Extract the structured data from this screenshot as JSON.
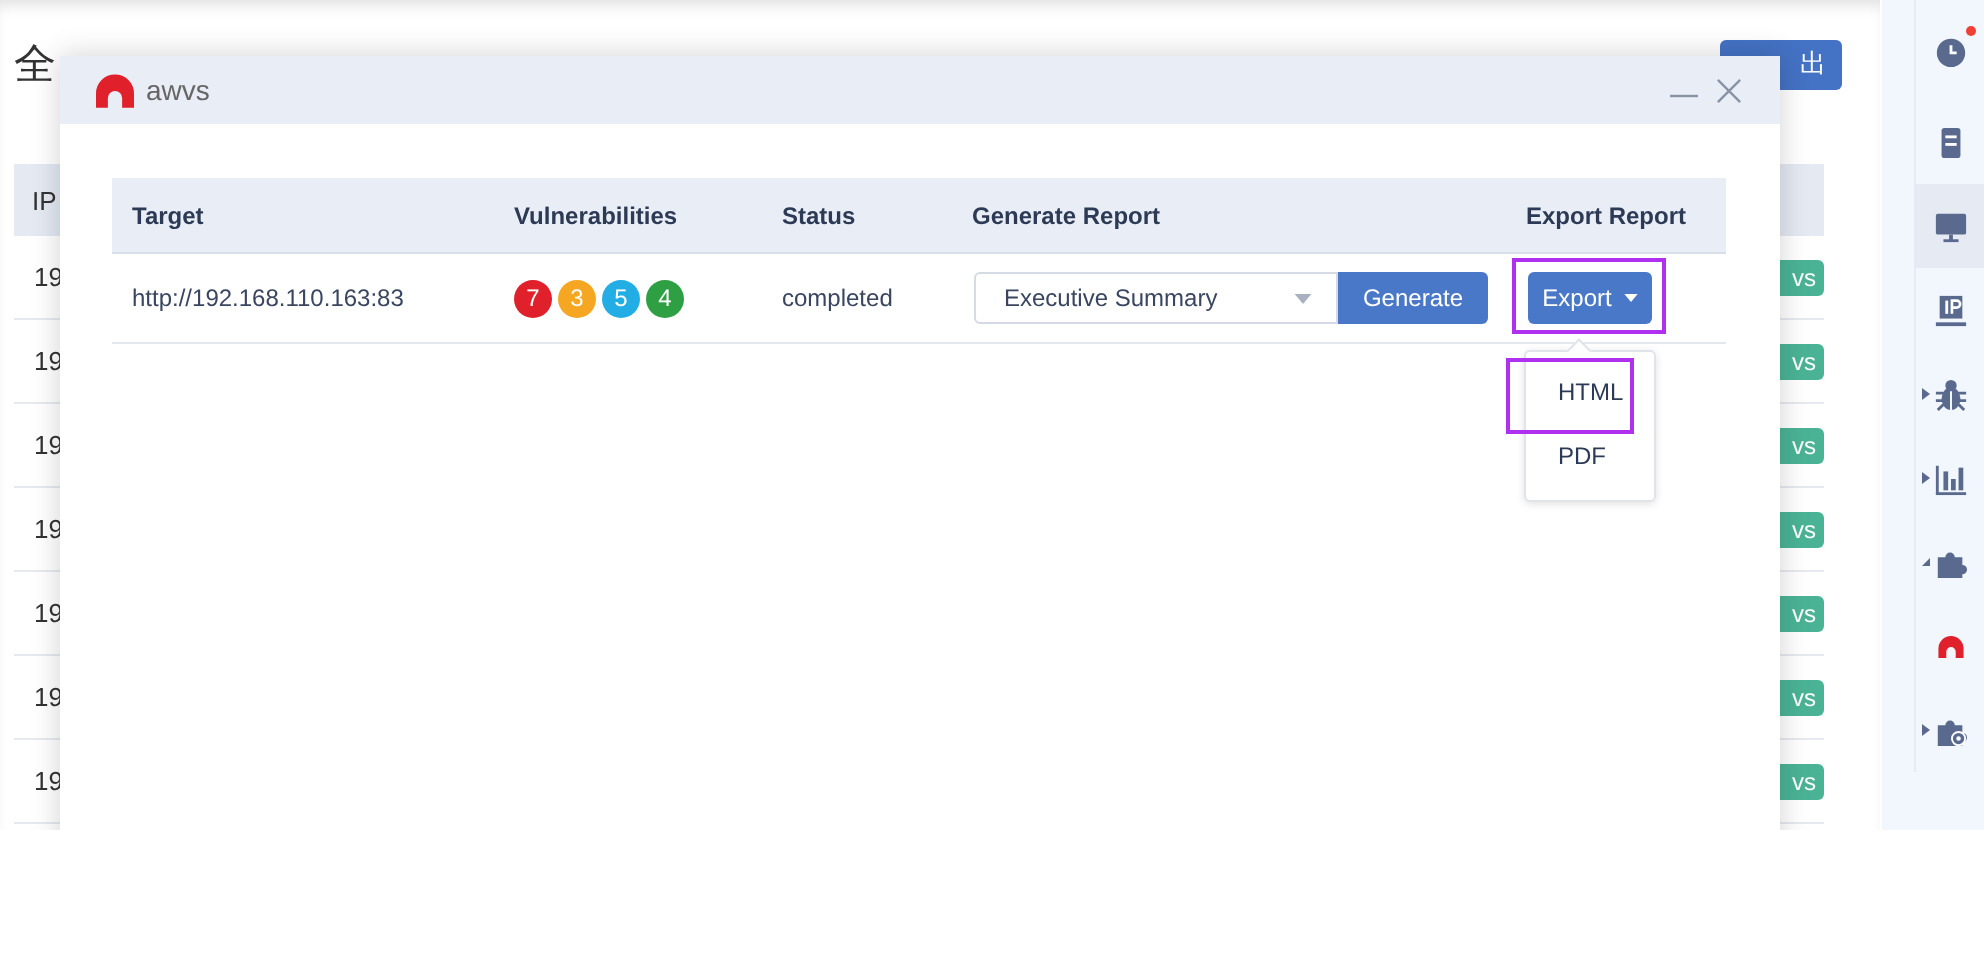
{
  "background_page": {
    "title": "全",
    "export_button": "出",
    "table": {
      "header": "IP",
      "rows": [
        {
          "ip": "19",
          "tag": "vs"
        },
        {
          "ip": "19",
          "tag": "vs"
        },
        {
          "ip": "19",
          "tag": "vs"
        },
        {
          "ip": "19",
          "tag": "vs"
        },
        {
          "ip": "19",
          "tag": "vs"
        },
        {
          "ip": "19",
          "tag": "vs"
        },
        {
          "ip": "19",
          "tag": "vs"
        }
      ]
    }
  },
  "sidebar": {
    "items": [
      {
        "kind": "clock",
        "selected": false,
        "badge": true
      },
      {
        "kind": "document",
        "selected": false,
        "badge": false
      },
      {
        "kind": "monitor",
        "selected": true,
        "badge": false
      },
      {
        "kind": "ip",
        "selected": false,
        "badge": false
      },
      {
        "kind": "bug",
        "selected": false,
        "badge": false,
        "expanded": false
      },
      {
        "kind": "chart",
        "selected": false,
        "badge": false,
        "expanded": false
      },
      {
        "kind": "puzzle",
        "selected": false,
        "badge": false,
        "expanded": true
      },
      {
        "kind": "logo",
        "selected": false,
        "badge": false
      },
      {
        "kind": "puzzle-gear",
        "selected": false,
        "badge": false,
        "expanded": false
      }
    ]
  },
  "dialog": {
    "title": "awvs",
    "table": {
      "columns": [
        "Target",
        "Vulnerabilities",
        "Status",
        "Generate Report",
        "Export Report"
      ],
      "rows": [
        {
          "target": "http://192.168.110.163:83",
          "vulnerabilities": [
            {
              "count": "7",
              "color": "#e0202a"
            },
            {
              "count": "3",
              "color": "#f5a623"
            },
            {
              "count": "5",
              "color": "#22aee5"
            },
            {
              "count": "4",
              "color": "#2ea043"
            }
          ],
          "status": "completed",
          "report_type": "Executive Summary",
          "generate_button": "Generate",
          "export_button": "Export",
          "export_highlighted": true
        }
      ]
    },
    "export_menu": {
      "items": [
        {
          "label": "HTML",
          "highlighted": true
        },
        {
          "label": "PDF",
          "highlighted": false
        }
      ]
    }
  }
}
